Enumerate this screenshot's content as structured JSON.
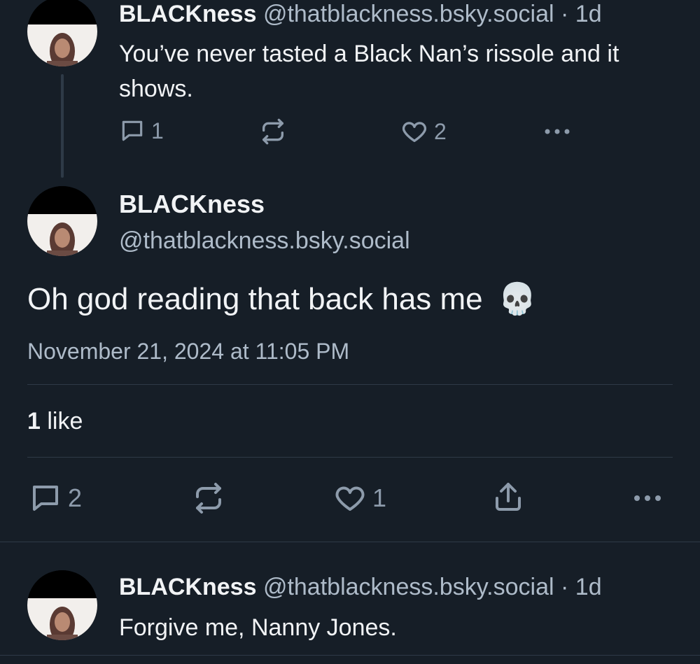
{
  "parent_post": {
    "display_name": "BLACKness",
    "handle": "@thatblackness.bsky.social",
    "time": "· 1d",
    "text": "You’ve never tasted a Black Nan’s rissole and it shows.",
    "replies": "1",
    "likes": "2",
    "icons": [
      "reply-icon",
      "repost-icon",
      "like-icon",
      "more-icon"
    ]
  },
  "main_post": {
    "display_name": "BLACKness",
    "handle": "@thatblackness.bsky.social",
    "text": "Oh god reading that back has me",
    "emoji": "💀",
    "timestamp": "November 21, 2024 at 11:05 PM",
    "like_count": "1",
    "like_label": "like",
    "replies": "2",
    "likes": "1",
    "icons": [
      "reply-icon",
      "repost-icon",
      "like-icon",
      "share-icon",
      "more-icon"
    ]
  },
  "reply_post": {
    "display_name": "BLACKness",
    "handle": "@thatblackness.bsky.social",
    "time": "· 1d",
    "text": "Forgive me, Nanny Jones."
  },
  "colors": {
    "background": "#161e27",
    "text": "#f1f3f5",
    "muted": "#aebbc9",
    "icon": "#8d9bab",
    "divider": "#2e3a47"
  }
}
